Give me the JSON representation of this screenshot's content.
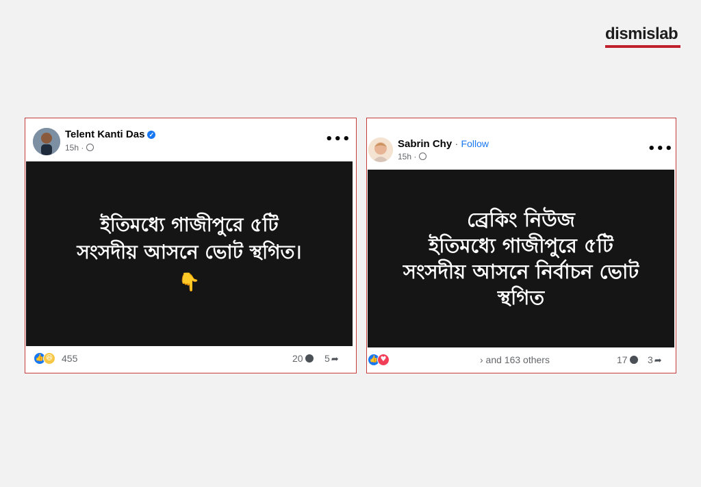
{
  "brand": {
    "logo_text": "dismislab",
    "accent_color": "#c0202b"
  },
  "posts": [
    {
      "author": "Telent Kanti Das",
      "verified": true,
      "time": "15h",
      "image_lines": [
        "ইতিমধ্যে গাজীপুরে ৫টি",
        "সংসদীয় আসনে ভোট স্থগিত।"
      ],
      "emoji": "👇",
      "reactions": [
        "like-icon",
        "haha-icon"
      ],
      "reaction_count": "455",
      "comments": "20",
      "shares": "5"
    },
    {
      "author": "Sabrin Chy",
      "follow_label": "Follow",
      "time": "15h",
      "image_lines": [
        "ব্রেকিং নিউজ",
        "ইতিমধ্যে গাজীপুরে ৫টি",
        "সংসদীয় আসনে নির্বাচন ভোট",
        "স্থগিত"
      ],
      "reactions": [
        "like-icon",
        "love-icon"
      ],
      "reaction_count": "› and 163 others",
      "comments": "17",
      "shares": "3"
    }
  ]
}
